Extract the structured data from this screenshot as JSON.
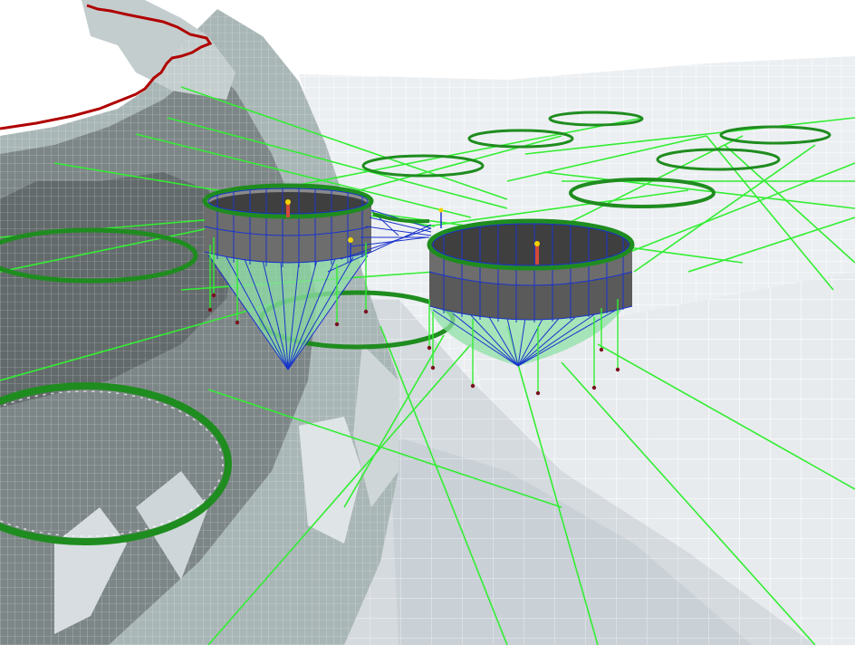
{
  "scene": {
    "colors": {
      "background": "#ffffff",
      "terrain_dark": "#6f7677",
      "terrain_mid": "#a7b3b3",
      "terrain_light": "#dde3e6",
      "seabed_light": "#eef0f3",
      "mesh_line": "#ffffff",
      "coastline": "#b00000",
      "mooring_line": "#33ee33",
      "ring": "#1f8c1f",
      "net": "#1a33cc",
      "net_wall": "#707070",
      "anchor": "#7a1020",
      "buoy": "#f2d200",
      "pole": "#d24a3a"
    }
  }
}
